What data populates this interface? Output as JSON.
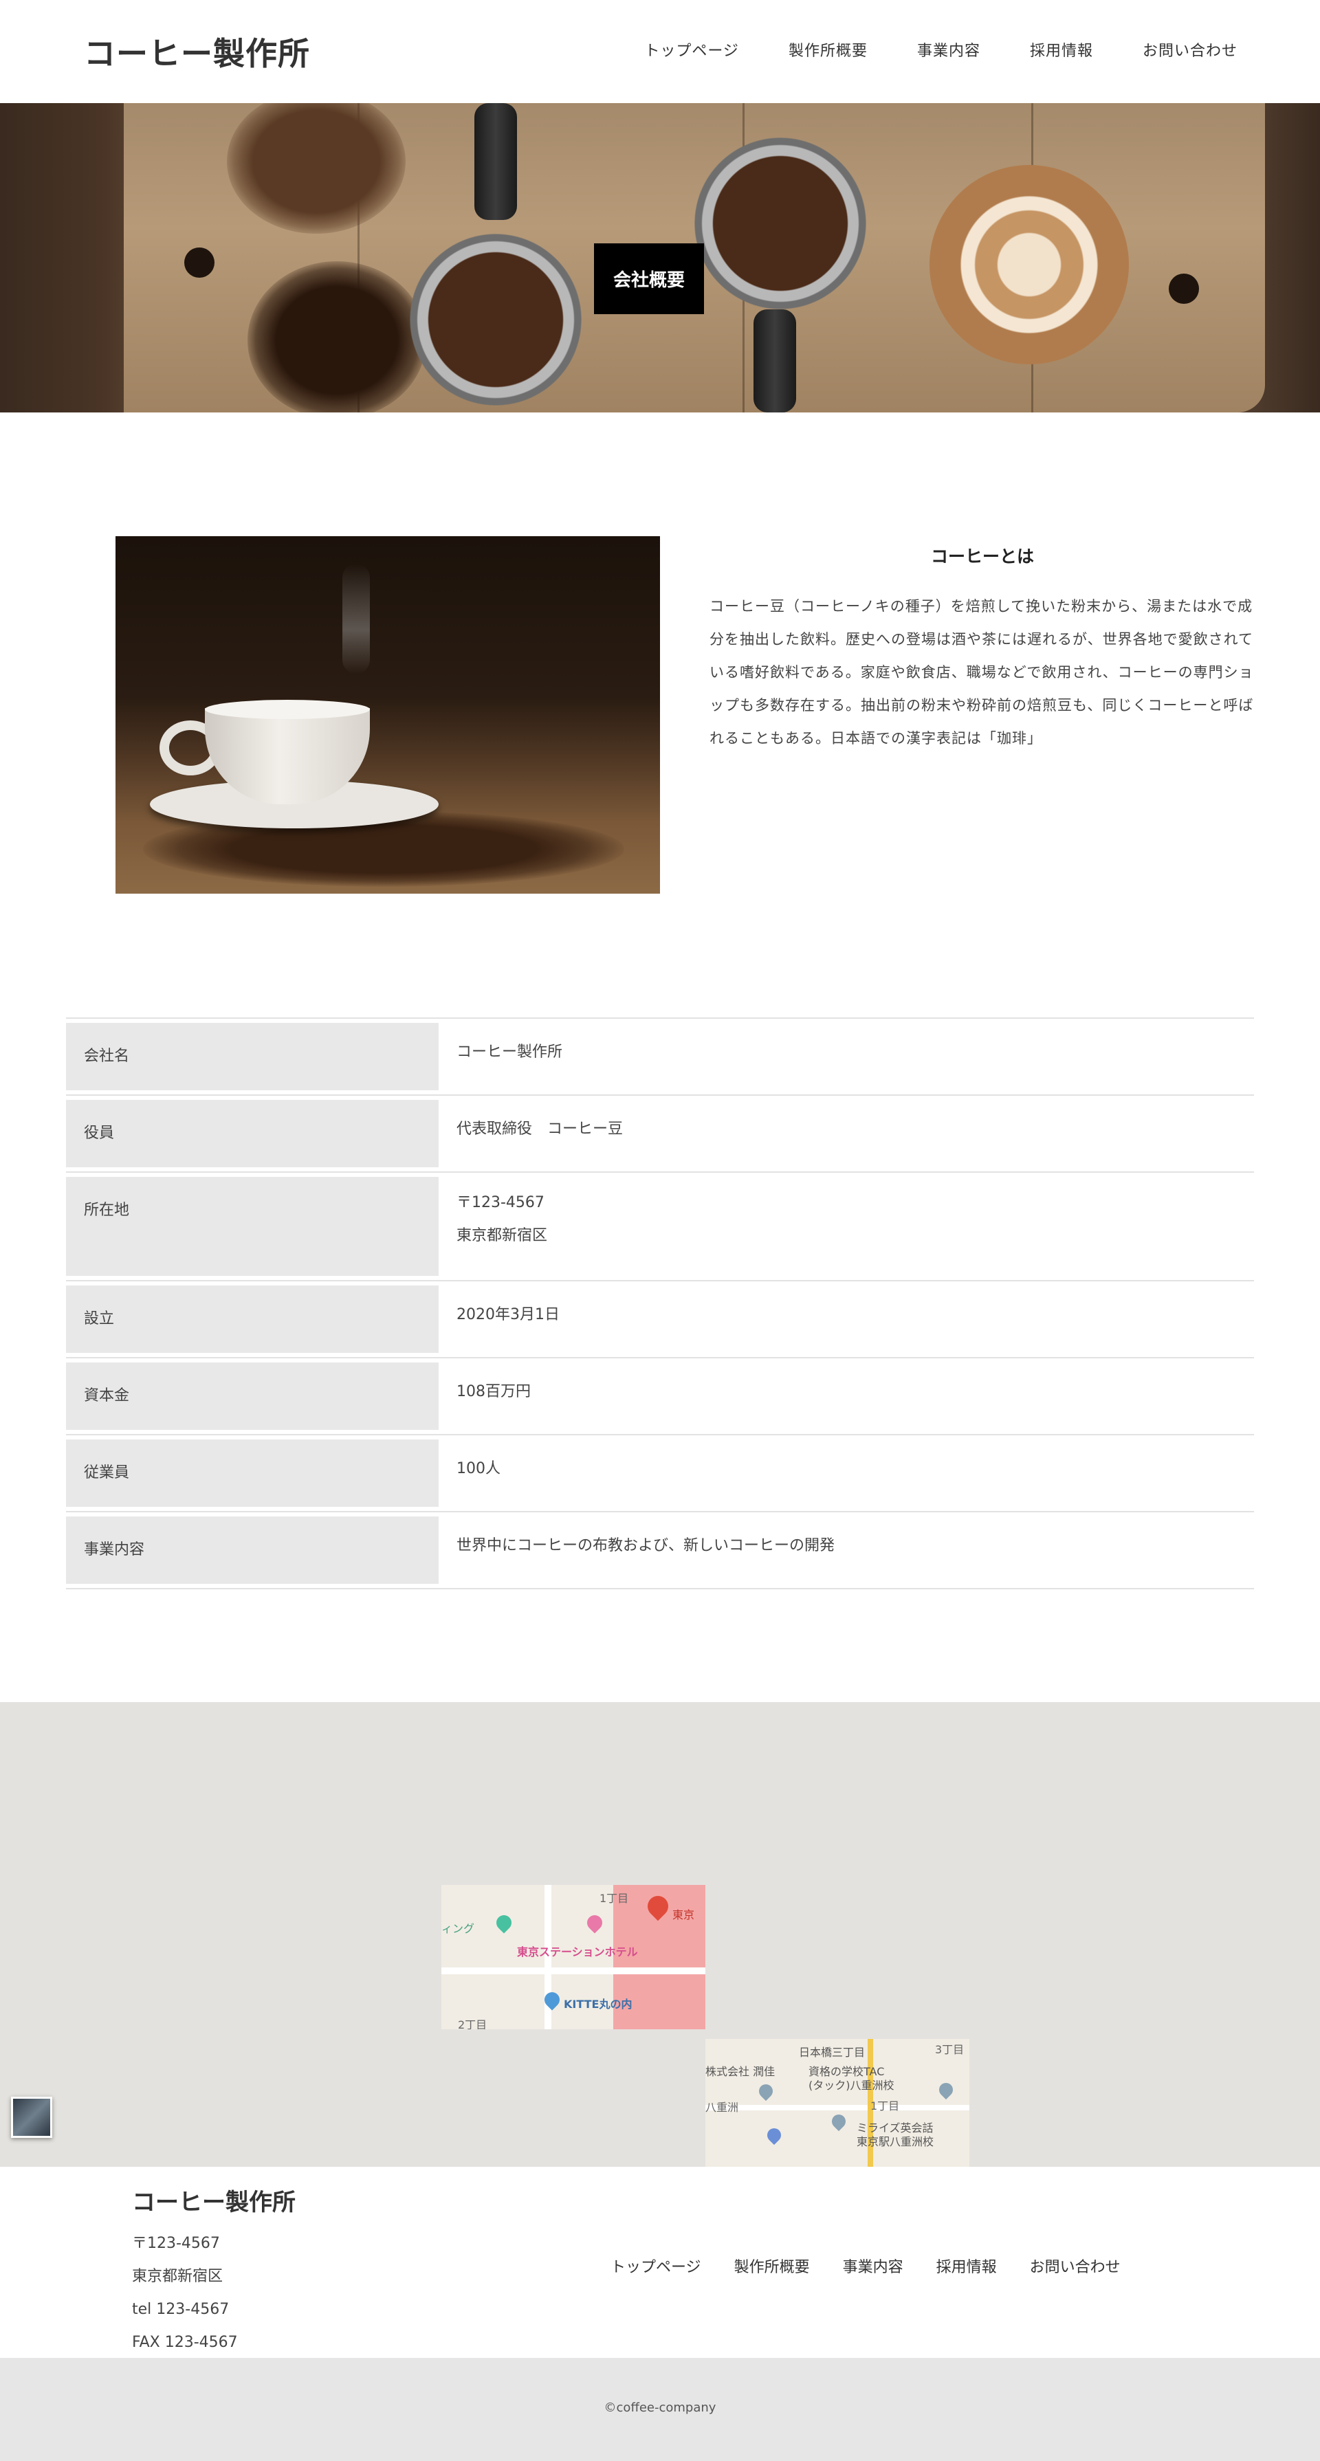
{
  "header": {
    "logo": "コーヒー製作所",
    "nav": [
      "トップページ",
      "製作所概要",
      "事業内容",
      "採用情報",
      "お問い合わせ"
    ]
  },
  "hero": {
    "title": "会社概要"
  },
  "about": {
    "title": "コーヒーとは",
    "text": "コーヒー豆（コーヒーノキの種子）を焙煎して挽いた粉末から、湯または水で成分を抽出した飲料。歴史への登場は酒や茶には遅れるが、世界各地で愛飲されている嗜好飲料である。家庭や飲食店、職場などで飲用され、コーヒーの専門ショップも多数存在する。抽出前の粉末や粉砕前の焙煎豆も、同じくコーヒーと呼ばれることもある。日本語での漢字表記は「珈琲」"
  },
  "company_table": [
    {
      "label": "会社名",
      "value": [
        "コーヒー製作所"
      ]
    },
    {
      "label": "役員",
      "value": [
        "代表取締役　コーヒー豆"
      ]
    },
    {
      "label": "所在地",
      "value": [
        "〒123-4567",
        "東京都新宿区"
      ]
    },
    {
      "label": "設立",
      "value": [
        "2020年3月1日"
      ]
    },
    {
      "label": "資本金",
      "value": [
        "108百万円"
      ]
    },
    {
      "label": "従業員",
      "value": [
        "100人"
      ]
    },
    {
      "label": "事業内容",
      "value": [
        "世界中にコーヒーの布教および、新しいコーヒーの開発"
      ]
    }
  ],
  "map": {
    "tile1_labels": [
      "東京ステーションホテル",
      "KITTE丸の内",
      "1丁目",
      "東京",
      "2丁目",
      "ィング"
    ],
    "tile2_labels": [
      "日本橋三丁目",
      "3丁目",
      "株式会社 潤佳",
      "資格の学校TAC",
      "(タック)八重洲校",
      "1丁目",
      "八重洲",
      "ミライズ英会話",
      "東京駅八重洲校"
    ]
  },
  "footer": {
    "logo": "コーヒー製作所",
    "address": [
      "〒123-4567",
      "東京都新宿区",
      "tel 123-4567",
      "FAX 123-4567"
    ],
    "nav": [
      "トップページ",
      "製作所概要",
      "事業内容",
      "採用情報",
      "お問い合わせ"
    ],
    "copyright": "©coffee-company"
  },
  "colors": {
    "hero_title_bg": "#000000",
    "table_label_bg": "#e8e8e8",
    "map_bg": "#e4e2de",
    "copyright_bg": "#e6e6e6"
  }
}
